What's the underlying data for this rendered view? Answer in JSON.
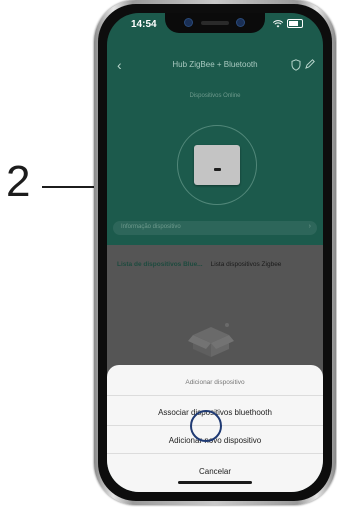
{
  "annotation": {
    "step_number": "2"
  },
  "status_bar": {
    "time": "14:54"
  },
  "header": {
    "back_icon": "chevron-left-icon",
    "title": "Hub ZigBee + Bluetooth"
  },
  "hub": {
    "online_label": "Dispositivos Online"
  },
  "info_bar": {
    "label": "Informação dispositivo",
    "chevron": "›"
  },
  "tabs": [
    {
      "label": "Lista de dispositivos  Blue..."
    },
    {
      "label": "Lista dispositivos Zigbee"
    }
  ],
  "sheet": {
    "title": "Adicionar dispositivo",
    "options": [
      {
        "label": "Associar dispositivos bluethooth"
      },
      {
        "label": "Adicionar novo dispositivo"
      },
      {
        "label": "Cancelar"
      }
    ]
  },
  "colors": {
    "screen_bg": "#1c5a4c",
    "highlight_circle": "#1f3a73",
    "tab_active": "#1d4a3e"
  }
}
